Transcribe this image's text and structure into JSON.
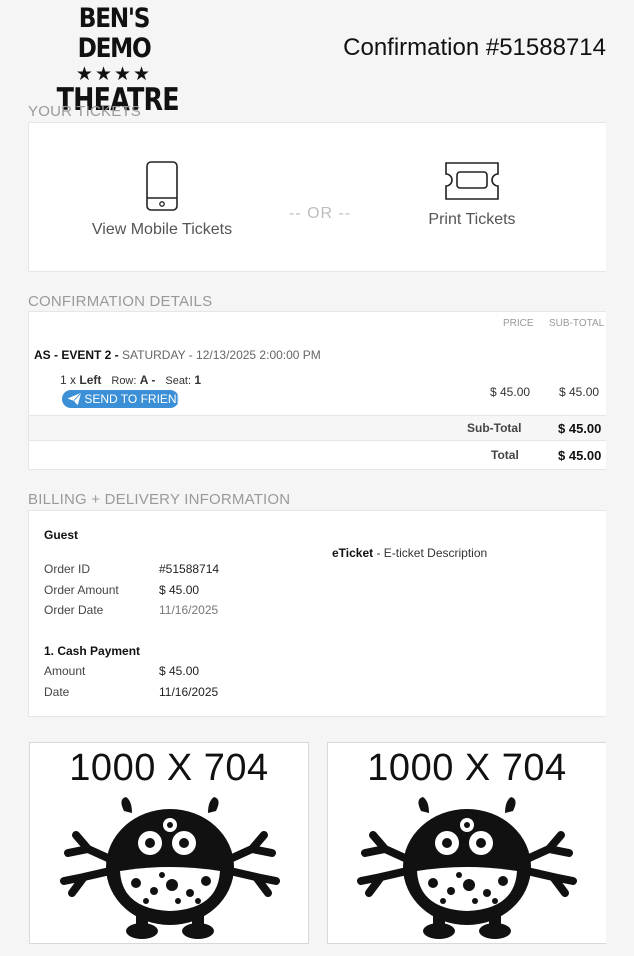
{
  "logo": {
    "line1": "BEN'S DEMO",
    "stars": "★★★★",
    "line3": "THEATRE"
  },
  "confirmation_title": "Confirmation #51588714",
  "tickets": {
    "section_label": "YOUR TICKETS",
    "mobile_label": "View Mobile Tickets",
    "or_label": "-- OR --",
    "print_label": "Print Tickets"
  },
  "details": {
    "section_label": "CONFIRMATION DETAILS",
    "col_price": "PRICE",
    "col_subtotal": "SUB-TOTAL",
    "event_name": "AS - EVENT 2 -",
    "event_when": "SATURDAY - 12/13/2025 2:00:00 PM",
    "qty": "1 x",
    "section": "Left",
    "row_label": "Row:",
    "row_value": "A -",
    "seat_label": "Seat:",
    "seat_value": "1",
    "send_label": "SEND TO FRIEND",
    "price": "$ 45.00",
    "line_subtotal": "$ 45.00",
    "subtotal_label": "Sub-Total",
    "subtotal_value": "$ 45.00",
    "total_label": "Total",
    "total_value": "$ 45.00"
  },
  "billing": {
    "section_label": "BILLING + DELIVERY INFORMATION",
    "customer": "Guest",
    "delivery_method": "eTicket",
    "delivery_desc": " - E-ticket Description",
    "order_id_label": "Order ID",
    "order_id": "#51588714",
    "order_amount_label": "Order Amount",
    "order_amount": "$ 45.00",
    "order_date_label": "Order Date",
    "order_date": "11/16/2025",
    "payment_title": "1. Cash Payment",
    "amount_label": "Amount",
    "amount": "$ 45.00",
    "date_label": "Date",
    "date": "11/16/2025"
  },
  "ads": [
    {
      "text": "1000 X 704"
    },
    {
      "text": "1000 X 704"
    }
  ]
}
